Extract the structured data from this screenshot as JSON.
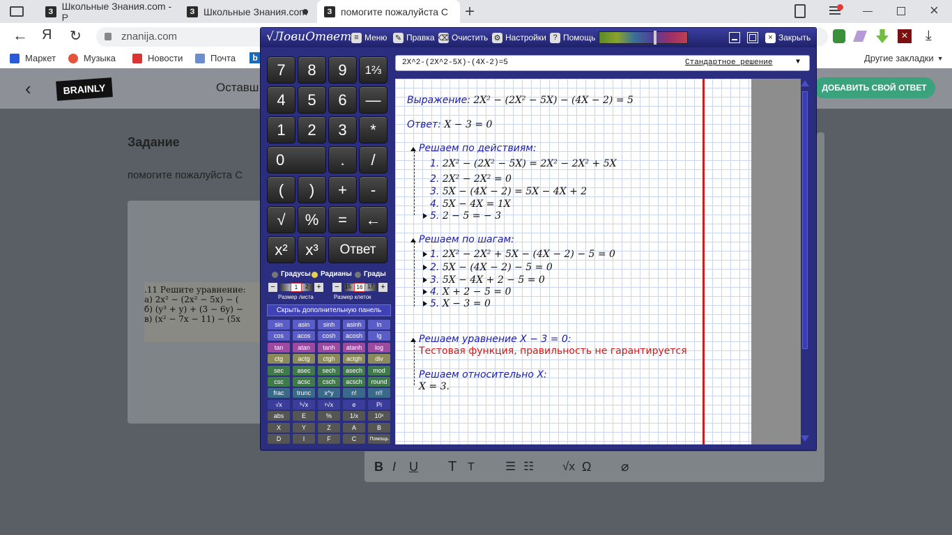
{
  "browser": {
    "tabs": [
      {
        "label": "Школьные Знания.com - Р"
      },
      {
        "label": "Школьные Знания.com"
      },
      {
        "label": "помогите пожалуйста С"
      }
    ],
    "address": "znanija.com",
    "bookmarks": [
      "Маркет",
      "Музыка",
      "Новости",
      "Почта"
    ],
    "other_bookmarks": "Другие закладки"
  },
  "site": {
    "logo": "BRAINLY",
    "header_text": "Оставш",
    "add_answer": "ДОБАВИТЬ СВОЙ ОТВЕТ",
    "task_title": "Задание",
    "task_text": "помогите пожалуйста С",
    "image_lines": [
      ".11 Решите уравнение:",
      "а) 2x² − (2x² − 5x) − (",
      "б) (y³ + y) + (3 − 6y) −",
      "в) (x² − 7x − 11) − (5x"
    ]
  },
  "calc": {
    "app_title": "√ЛовиОтвет",
    "menu": "Меню",
    "edit": "Правка",
    "clear": "Очистить",
    "settings": "Настройки",
    "help": "Помощь",
    "close": "Закрыть",
    "keys": [
      "7",
      "8",
      "9",
      "1⅔",
      "4",
      "5",
      "6",
      "—",
      "1",
      "2",
      "3",
      "*",
      "0",
      ".",
      "/",
      "(",
      ")",
      "+",
      "-",
      "√",
      "%",
      "=",
      "←",
      "x²",
      "x³",
      "Ответ"
    ],
    "angle_modes": [
      "Градусы",
      "Радианы",
      "Грады"
    ],
    "sheet_size_label": "Размер листа",
    "cell_size_label": "Размер клеток",
    "sheet_size_values": [
      "1",
      "2"
    ],
    "cell_size_values": [
      "15",
      "16",
      "17"
    ],
    "hide_panel": "Скрыть дополнительную панель",
    "func_keys": [
      "sin",
      "asin",
      "sinh",
      "asinh",
      "ln",
      "cos",
      "acos",
      "cosh",
      "acosh",
      "lg",
      "tan",
      "atan",
      "tanh",
      "atanh",
      "log",
      "ctg",
      "actg",
      "ctgh",
      "actgh",
      "div",
      "sec",
      "asec",
      "sech",
      "asech",
      "mod",
      "csc",
      "acsc",
      "csch",
      "acsch",
      "round",
      "frac",
      "trunc",
      "x^y",
      "n!",
      "n!!",
      "√x",
      "³√x",
      "ʸ√x",
      "e",
      "Pi",
      "abs",
      "E",
      "%",
      "1/x",
      "10ˣ",
      "X",
      "Y",
      "Z",
      "A",
      "B",
      "D",
      "I",
      "F",
      "C",
      "Помощь"
    ],
    "expression": "2X^2-(2X^2-5X)-(4X-2)=5",
    "mode": "Стандартное решение",
    "sheet": {
      "expr_label": "Выражение:",
      "expr": "2X² − (2X² − 5X) − (4X − 2) = 5",
      "answer_label": "Ответ:",
      "answer": "X − 3 = 0",
      "actions_title": "Решаем по действиям:",
      "actions": [
        {
          "n": "1.",
          "t": "2X² − (2X² − 5X) = 2X² − 2X² + 5X"
        },
        {
          "n": "2.",
          "t": "2X² − 2X² = 0"
        },
        {
          "n": "3.",
          "t": "5X − (4X − 2) = 5X − 4X + 2"
        },
        {
          "n": "4.",
          "t": "5X − 4X = 1X"
        },
        {
          "n": "5.",
          "t": "2 − 5 = − 3"
        }
      ],
      "steps_title": "Решаем по шагам:",
      "steps": [
        {
          "n": "1.",
          "t": "2X² − 2X² + 5X − (4X − 2) − 5 = 0"
        },
        {
          "n": "2.",
          "t": "5X − (4X − 2) − 5 = 0"
        },
        {
          "n": "3.",
          "t": "5X − 4X + 2 − 5 = 0"
        },
        {
          "n": "4.",
          "t": "X + 2 − 5 = 0"
        },
        {
          "n": "5.",
          "t": "X − 3 = 0"
        }
      ],
      "equation_title": "Решаем уравнение X − 3 = 0:",
      "warning": "Тестовая функция, правильность не гарантируется",
      "relative_title": "Решаем относительно X:",
      "result": "X = 3."
    }
  }
}
